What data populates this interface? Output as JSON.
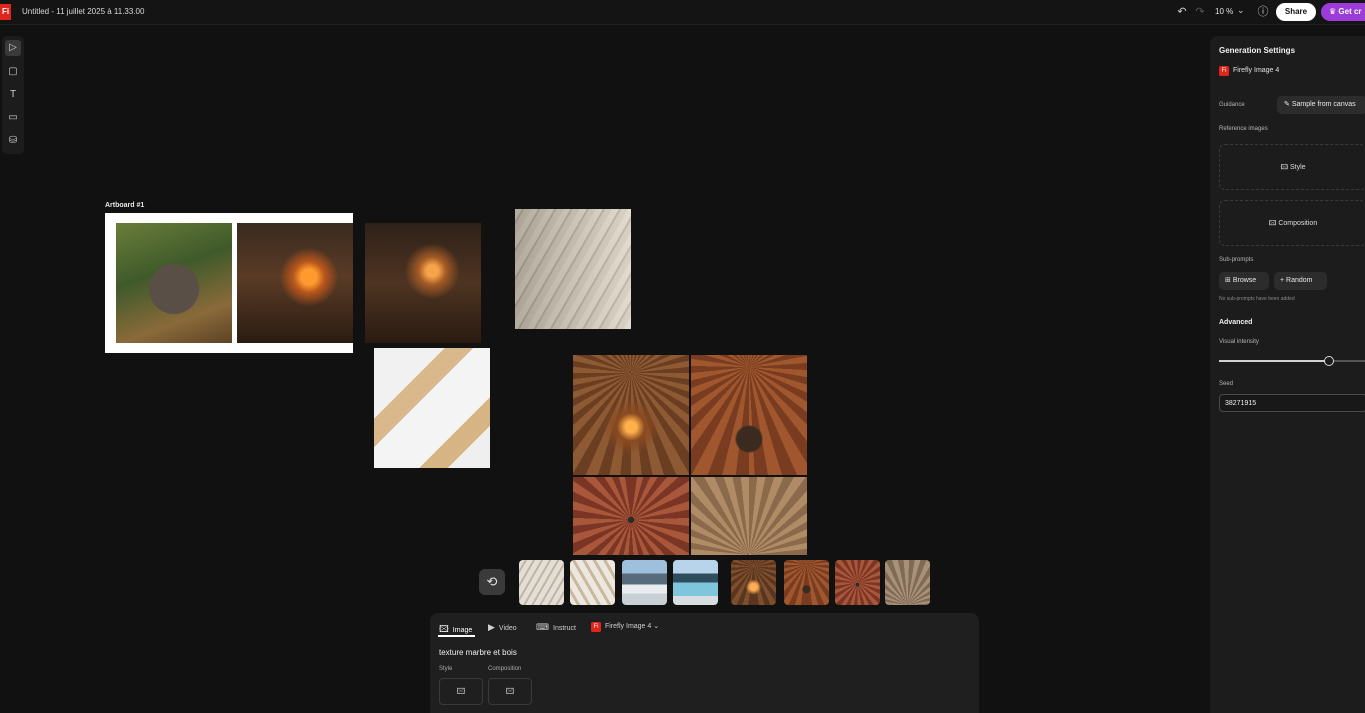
{
  "app": {
    "logo_text": "Fi",
    "document_title": "Untitled - 11 juillet 2025 à 11.33.00"
  },
  "topbar": {
    "zoom_level": "10 %",
    "share_label": "Share",
    "get_credits_label": "Get cr",
    "icons": [
      "undo-icon",
      "redo-icon",
      "chevron-down-icon",
      "help-icon",
      "crown-icon"
    ]
  },
  "toolbar": {
    "tools": [
      "select-tool",
      "artboard-tool",
      "text-tool",
      "shape-tool",
      "generate-fill-tool"
    ]
  },
  "canvas": {
    "artboard_label": "Artboard #1",
    "images": [
      "anvil-outdoor",
      "forge-workshop",
      "forge-workshop-2",
      "feather-wood-texture",
      "marble-wood-texture",
      "forge-hall-1",
      "forge-hall-2",
      "forge-hall-3",
      "forge-hall-4"
    ]
  },
  "history": {
    "icon": "history-icon",
    "thumbnails": [
      "chevron-wood-1",
      "chevron-wood-2",
      "mountain-view",
      "pool-view",
      "forge-hall-1",
      "forge-hall-2",
      "forge-hall-3",
      "forge-hall-4"
    ]
  },
  "prompt_panel": {
    "tabs": [
      {
        "label": "Image",
        "icon": "image-icon"
      },
      {
        "label": "Video",
        "icon": "video-icon"
      },
      {
        "label": "Instruct",
        "icon": "instruct-icon"
      }
    ],
    "model_label": "Firefly Image 4",
    "prompt": "texture marbre et bois",
    "style_label": "Style",
    "composition_label": "Composition"
  },
  "generation_settings": {
    "title": "Generation Settings",
    "model": "Firefly Image 4",
    "guidance_label": "Guidance",
    "sample_button": "Sample from canvas",
    "reference_images_label": "Reference images",
    "style_button": "Style",
    "composition_button": "Composition",
    "subprompts_label": "Sub-prompts",
    "browse_button": "Browse",
    "random_button": "Random",
    "subprompts_note": "No sub-prompts have been added",
    "advanced_label": "Advanced",
    "visual_intensity_label": "Visual intensity",
    "visual_intensity_value": 0.74,
    "seed_label": "Seed",
    "seed_value": "38271915"
  }
}
